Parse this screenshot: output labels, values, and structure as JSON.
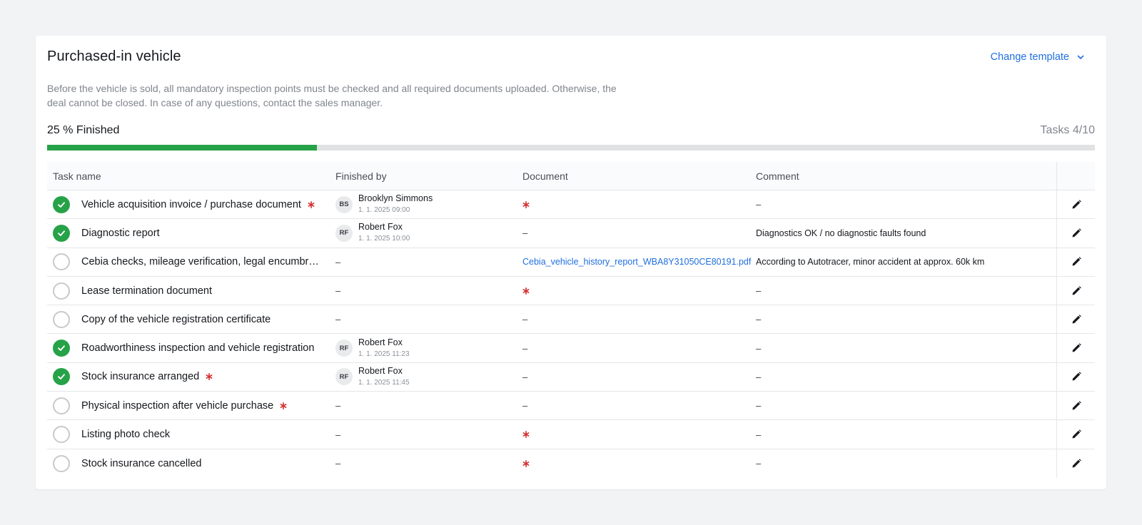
{
  "header": {
    "title": "Purchased-in vehicle",
    "change_template_label": "Change template",
    "description": "Before the vehicle is sold, all mandatory inspection points must be checked and all required documents uploaded. Otherwise, the deal cannot be closed. In case of any questions, contact the sales manager."
  },
  "progress": {
    "label": "25 % Finished",
    "fraction": 0.2578,
    "tasks_label": "Tasks 4/10"
  },
  "colors": {
    "accent": "#1f6fe0",
    "success": "#26a248",
    "required": "#d62c2c"
  },
  "table": {
    "columns": {
      "task": "Task name",
      "finished_by": "Finished by",
      "document": "Document",
      "comment": "Comment"
    },
    "empty": "–",
    "rows": [
      {
        "done": true,
        "name": "Vehicle acquisition invoice / purchase document",
        "required": true,
        "by": {
          "initials": "BS",
          "name": "Brooklyn Simmons",
          "date": "1. 1. 2025 09:00"
        },
        "doc": {
          "type": "required"
        },
        "comment": "–"
      },
      {
        "done": true,
        "name": "Diagnostic report",
        "required": false,
        "by": {
          "initials": "RF",
          "name": "Robert Fox",
          "date": "1. 1. 2025 10:00"
        },
        "doc": {
          "type": "empty"
        },
        "comment": "Diagnostics OK / no diagnostic faults found"
      },
      {
        "done": false,
        "name": "Cebia checks, mileage verification, legal encumbran...",
        "required": false,
        "by": null,
        "doc": {
          "type": "link",
          "label": "Cebia_vehicle_history_report_WBA8Y31050CE80191.pdf"
        },
        "comment": "According to Autotracer, minor accident at approx. 60k km"
      },
      {
        "done": false,
        "name": "Lease termination document",
        "required": false,
        "by": null,
        "doc": {
          "type": "required"
        },
        "comment": "–"
      },
      {
        "done": false,
        "name": "Copy of the vehicle registration certificate",
        "required": false,
        "by": null,
        "doc": {
          "type": "empty"
        },
        "comment": "–"
      },
      {
        "done": true,
        "name": "Roadworthiness inspection and vehicle registration",
        "required": false,
        "by": {
          "initials": "RF",
          "name": "Robert Fox",
          "date": "1. 1. 2025 11:23"
        },
        "doc": {
          "type": "empty"
        },
        "comment": "–"
      },
      {
        "done": true,
        "name": "Stock insurance arranged",
        "required": true,
        "by": {
          "initials": "RF",
          "name": "Robert Fox",
          "date": "1. 1. 2025 11:45"
        },
        "doc": {
          "type": "empty"
        },
        "comment": "–"
      },
      {
        "done": false,
        "name": "Physical inspection after vehicle purchase",
        "required": true,
        "by": null,
        "doc": {
          "type": "empty"
        },
        "comment": "–"
      },
      {
        "done": false,
        "name": "Listing photo check",
        "required": false,
        "by": null,
        "doc": {
          "type": "required"
        },
        "comment": "–"
      },
      {
        "done": false,
        "name": "Stock insurance cancelled",
        "required": false,
        "by": null,
        "doc": {
          "type": "required"
        },
        "comment": "–"
      }
    ]
  }
}
